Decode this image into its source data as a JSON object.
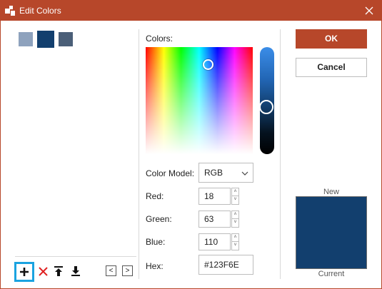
{
  "window": {
    "title": "Edit Colors",
    "close_icon": "close-icon",
    "app_icon": "app-shapes-icon",
    "accent_color": "#b7472a"
  },
  "swatches": [
    {
      "color": "#8ea2bd",
      "selected": false
    },
    {
      "color": "#123f6e",
      "selected": true
    },
    {
      "color": "#4b5f78",
      "selected": false
    }
  ],
  "toolbar": {
    "add_icon": "plus-icon",
    "delete_icon": "delete-x-icon",
    "move_up_icon": "move-up-icon",
    "move_down_icon": "move-down-icon",
    "prev_icon": "chevron-left-icon",
    "next_icon": "chevron-right-icon",
    "prev_glyph": "<",
    "next_glyph": ">"
  },
  "picker": {
    "colors_label": "Colors:",
    "color_model_label": "Color Model:",
    "color_model_value": "RGB",
    "red_label": "Red:",
    "red_value": "18",
    "green_label": "Green:",
    "green_value": "63",
    "blue_label": "Blue:",
    "blue_value": "110",
    "hex_label": "Hex:",
    "hex_value": "#123F6E"
  },
  "buttons": {
    "ok_label": "OK",
    "cancel_label": "Cancel"
  },
  "preview": {
    "new_label": "New",
    "current_label": "Current",
    "new_color": "#123f6e",
    "current_color": "#123f6e"
  }
}
